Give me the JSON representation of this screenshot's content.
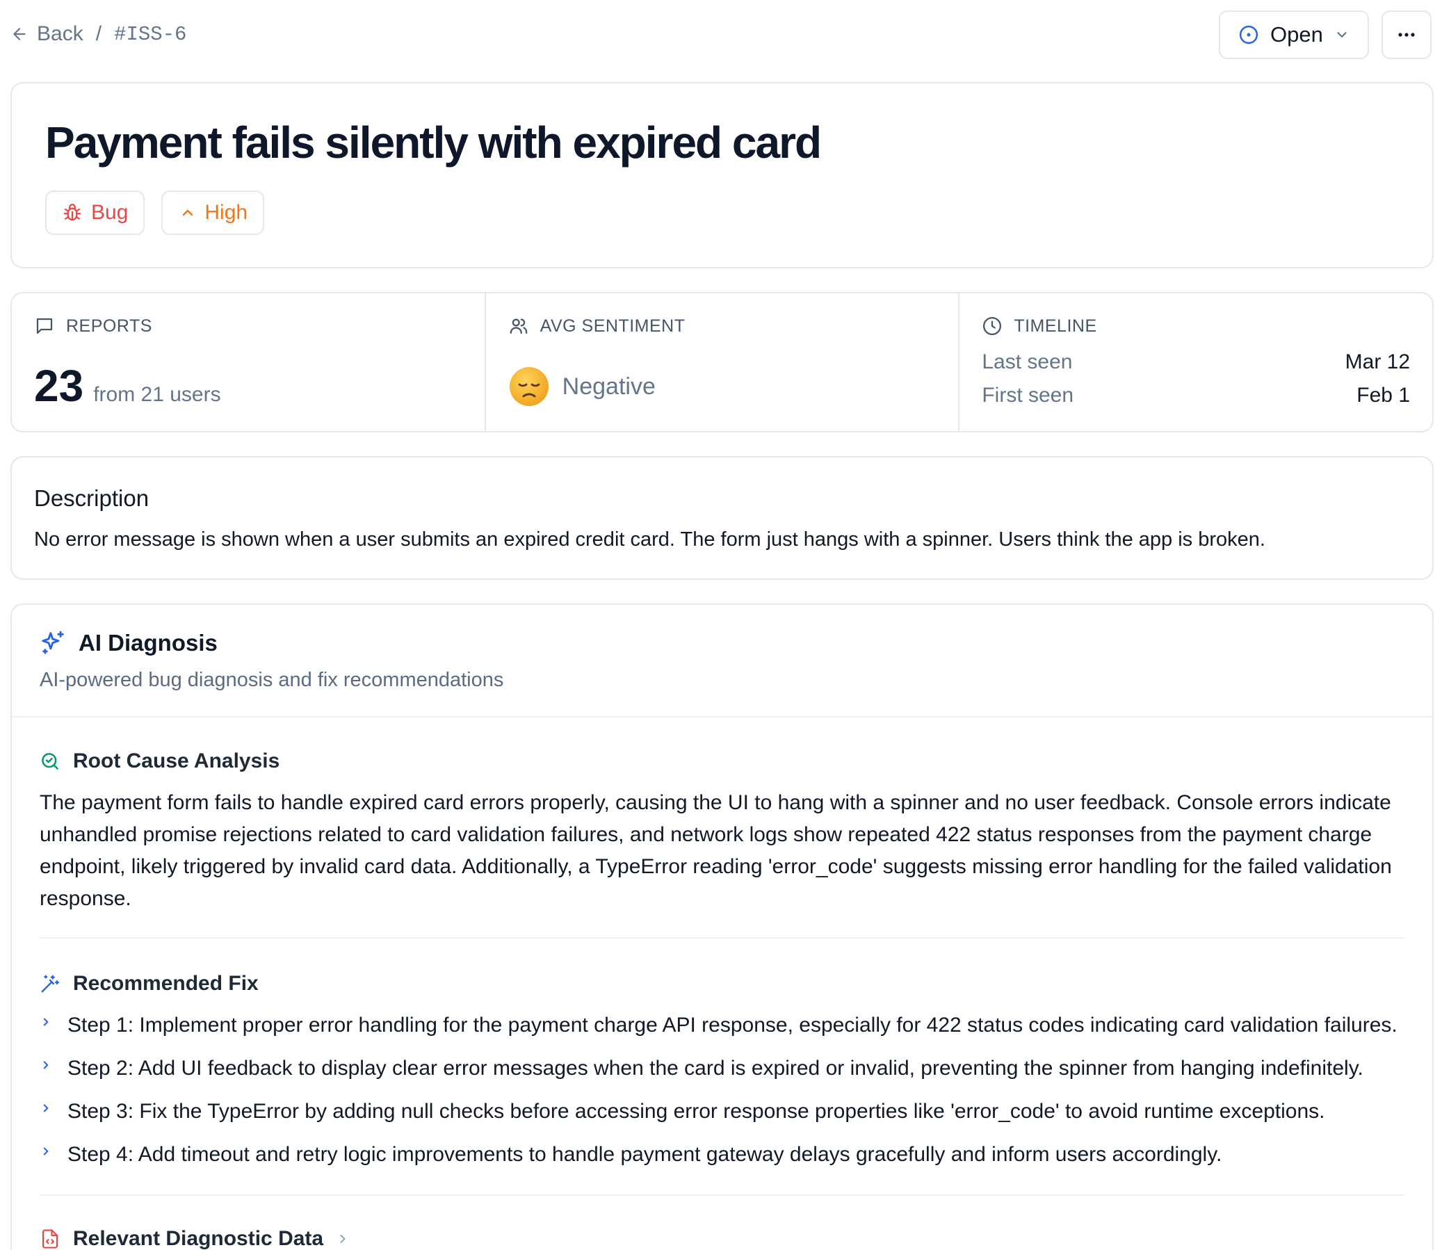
{
  "breadcrumb": {
    "back_label": "Back",
    "separator": "/",
    "issue_id": "#ISS-6"
  },
  "status": {
    "label": "Open",
    "color": "#2563eb"
  },
  "issue": {
    "title": "Payment fails silently with expired card",
    "type_label": "Bug",
    "type_color": "#ef4444",
    "priority_label": "High",
    "priority_color": "#f97316"
  },
  "stats": {
    "reports": {
      "label": "REPORTS",
      "count": "23",
      "sub": "from 21 users"
    },
    "sentiment": {
      "label": "AVG SENTIMENT",
      "value": "Negative",
      "emoji": "disappointed-face"
    },
    "timeline": {
      "label": "TIMELINE",
      "last_seen_label": "Last seen",
      "last_seen": "Mar 12",
      "first_seen_label": "First seen",
      "first_seen": "Feb 1"
    }
  },
  "description": {
    "heading": "Description",
    "text": "No error message is shown when a user submits an expired credit card. The form just hangs with a spinner. Users think the app is broken."
  },
  "ai": {
    "title": "AI Diagnosis",
    "subtitle": "AI-powered bug diagnosis and fix recommendations",
    "root_cause": {
      "heading": "Root Cause Analysis",
      "text": "The payment form fails to handle expired card errors properly, causing the UI to hang with a spinner and no user feedback. Console errors indicate unhandled promise rejections related to card validation failures, and network logs show repeated 422 status responses from the payment charge endpoint, likely triggered by invalid card data. Additionally, a TypeError reading 'error_code' suggests missing error handling for the failed validation response."
    },
    "fix": {
      "heading": "Recommended Fix",
      "steps": [
        "Step 1: Implement proper error handling for the payment charge API response, especially for 422 status codes indicating card validation failures.",
        "Step 2: Add UI feedback to display clear error messages when the card is expired or invalid, preventing the spinner from hanging indefinitely.",
        "Step 3: Fix the TypeError by adding null checks before accessing error response properties like 'error_code' to avoid runtime exceptions.",
        "Step 4: Add timeout and retry logic improvements to handle payment gateway delays gracefully and inform users accordingly."
      ]
    },
    "diagnostic": {
      "heading": "Relevant Diagnostic Data"
    }
  }
}
